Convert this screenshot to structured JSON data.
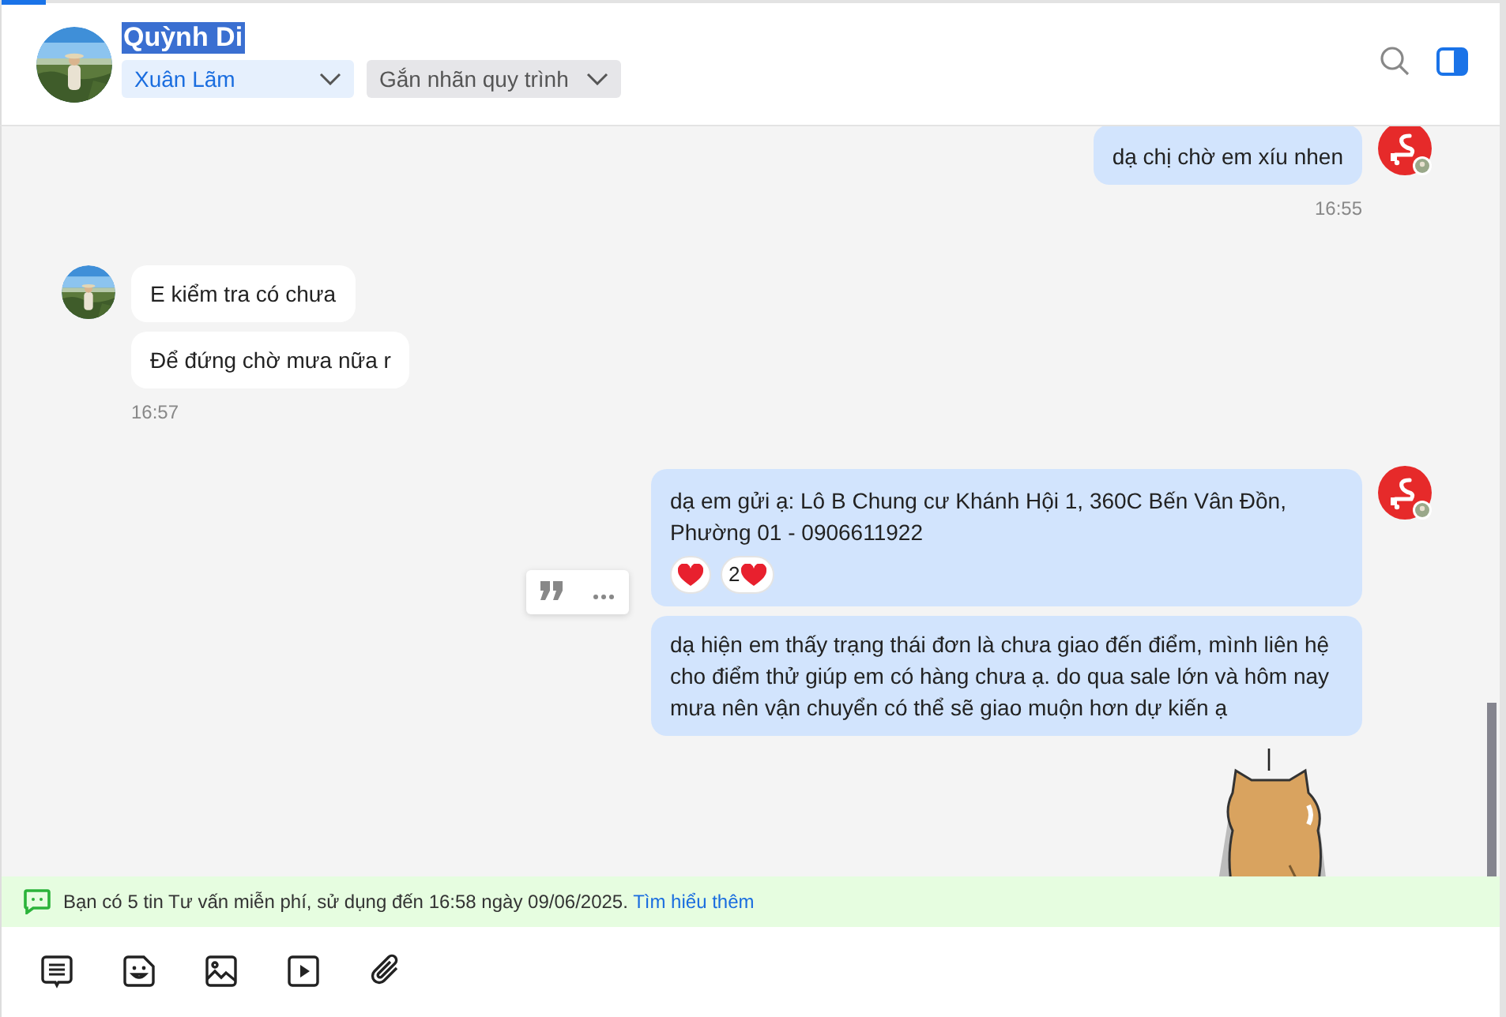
{
  "header": {
    "name": "Quỳnh Di",
    "name_selected": true,
    "assignee": "Xuân Lãm",
    "tag_placeholder": "Gắn nhãn quy trình"
  },
  "groups": [
    {
      "kind": "outgoing",
      "bubbles": [
        {
          "kind": "text",
          "text": "dạ chị chờ em xíu nhen"
        }
      ],
      "time": "16:55"
    },
    {
      "kind": "incoming",
      "bubbles": [
        {
          "kind": "text",
          "text": "E kiểm tra có chưa"
        },
        {
          "kind": "text",
          "text": "Để đứng chờ mưa nữa r"
        }
      ],
      "time": "16:57"
    },
    {
      "kind": "outgoing",
      "bubbles": [
        {
          "kind": "text",
          "text": "dạ em gửi ạ: Lô B Chung cư Khánh Hội 1, 360C Bến Vân Đồn, Phường 01 - 0906611922",
          "reaction_count": "2",
          "hover_actions": true
        },
        {
          "kind": "text",
          "text": "dạ hiện em thấy trạng thái đơn là chưa giao đến điểm, mình liên hệ cho điểm thử giúp em có hàng chưa ạ. do qua sale lớn và hôm nay mưa nên vận chuyển có thể sẽ giao muộn hơn dự kiến ạ"
        },
        {
          "kind": "sticker"
        }
      ]
    }
  ],
  "notice": {
    "text": "Bạn có 5 tin Tư vấn miễn phí, sử dụng đến 16:58 ngày 09/06/2025.",
    "link": "Tìm hiểu thêm"
  }
}
